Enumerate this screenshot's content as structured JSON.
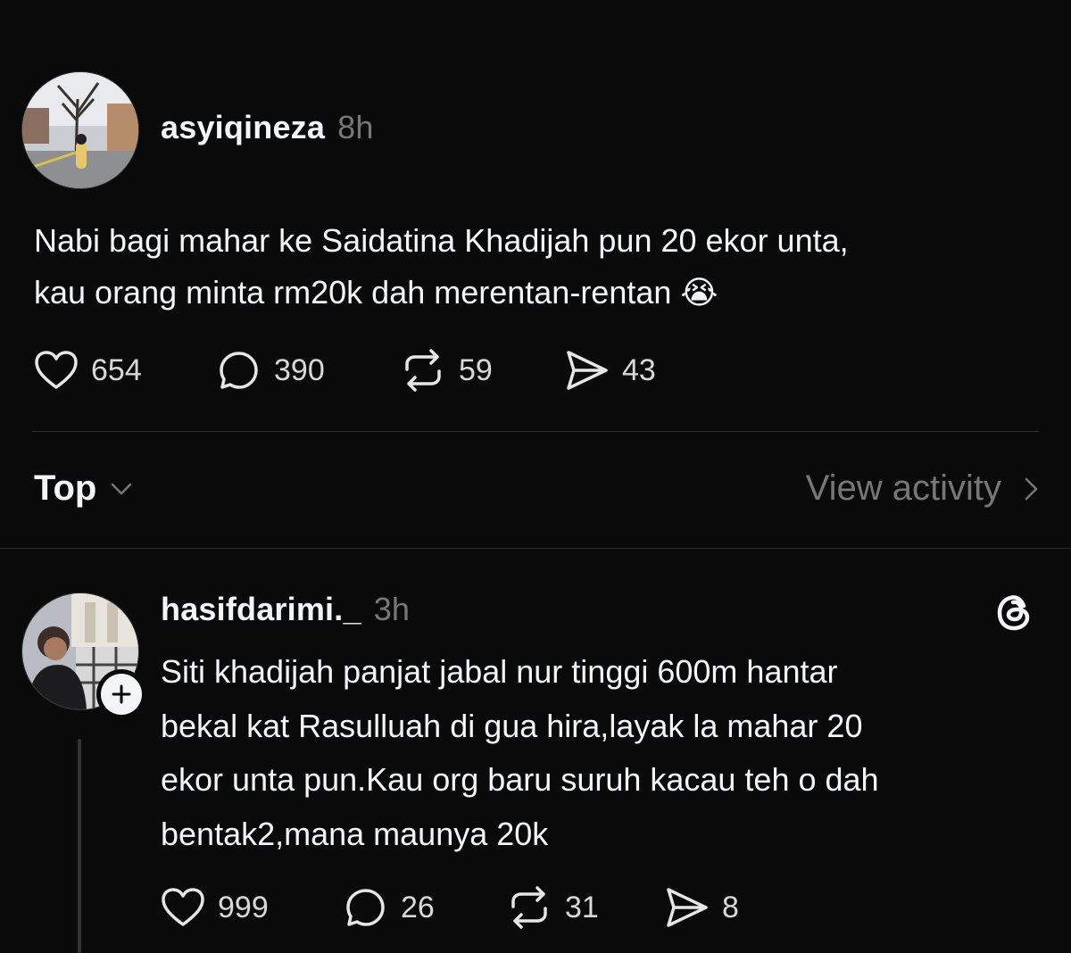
{
  "post": {
    "username": "asyiqineza",
    "time": "8h",
    "text_lines": [
      "Nabi bagi mahar ke Saidatina Khadijah pun 20 ekor unta,",
      "kau orang minta rm20k dah merentan-rentan 😭"
    ],
    "likes": "654",
    "replies": "390",
    "reposts": "59",
    "shares": "43"
  },
  "sort": {
    "label": "Top",
    "view_activity": "View activity"
  },
  "reply": {
    "username": "hasifdarimi._",
    "time": "3h",
    "text_lines": [
      "Siti khadijah panjat jabal nur tinggi 600m hantar",
      "bekal kat Rasulluah di gua hira,layak la mahar 20",
      "ekor unta pun.Kau org baru suruh kacau teh o dah",
      "bentak2,mana maunya 20k"
    ],
    "likes": "999",
    "replies": "26",
    "reposts": "31",
    "shares": "8"
  },
  "icons": {
    "like": "heart-icon",
    "reply": "comment-icon",
    "repost": "repost-icon",
    "share": "send-icon",
    "sort": "chevron-down-icon",
    "view_activity": "chevron-right-icon",
    "follow": "plus-icon",
    "brand": "threads-logo-icon"
  },
  "colors": {
    "background": "#0a0a0a",
    "text": "#f3f5f7",
    "muted": "#777777"
  }
}
